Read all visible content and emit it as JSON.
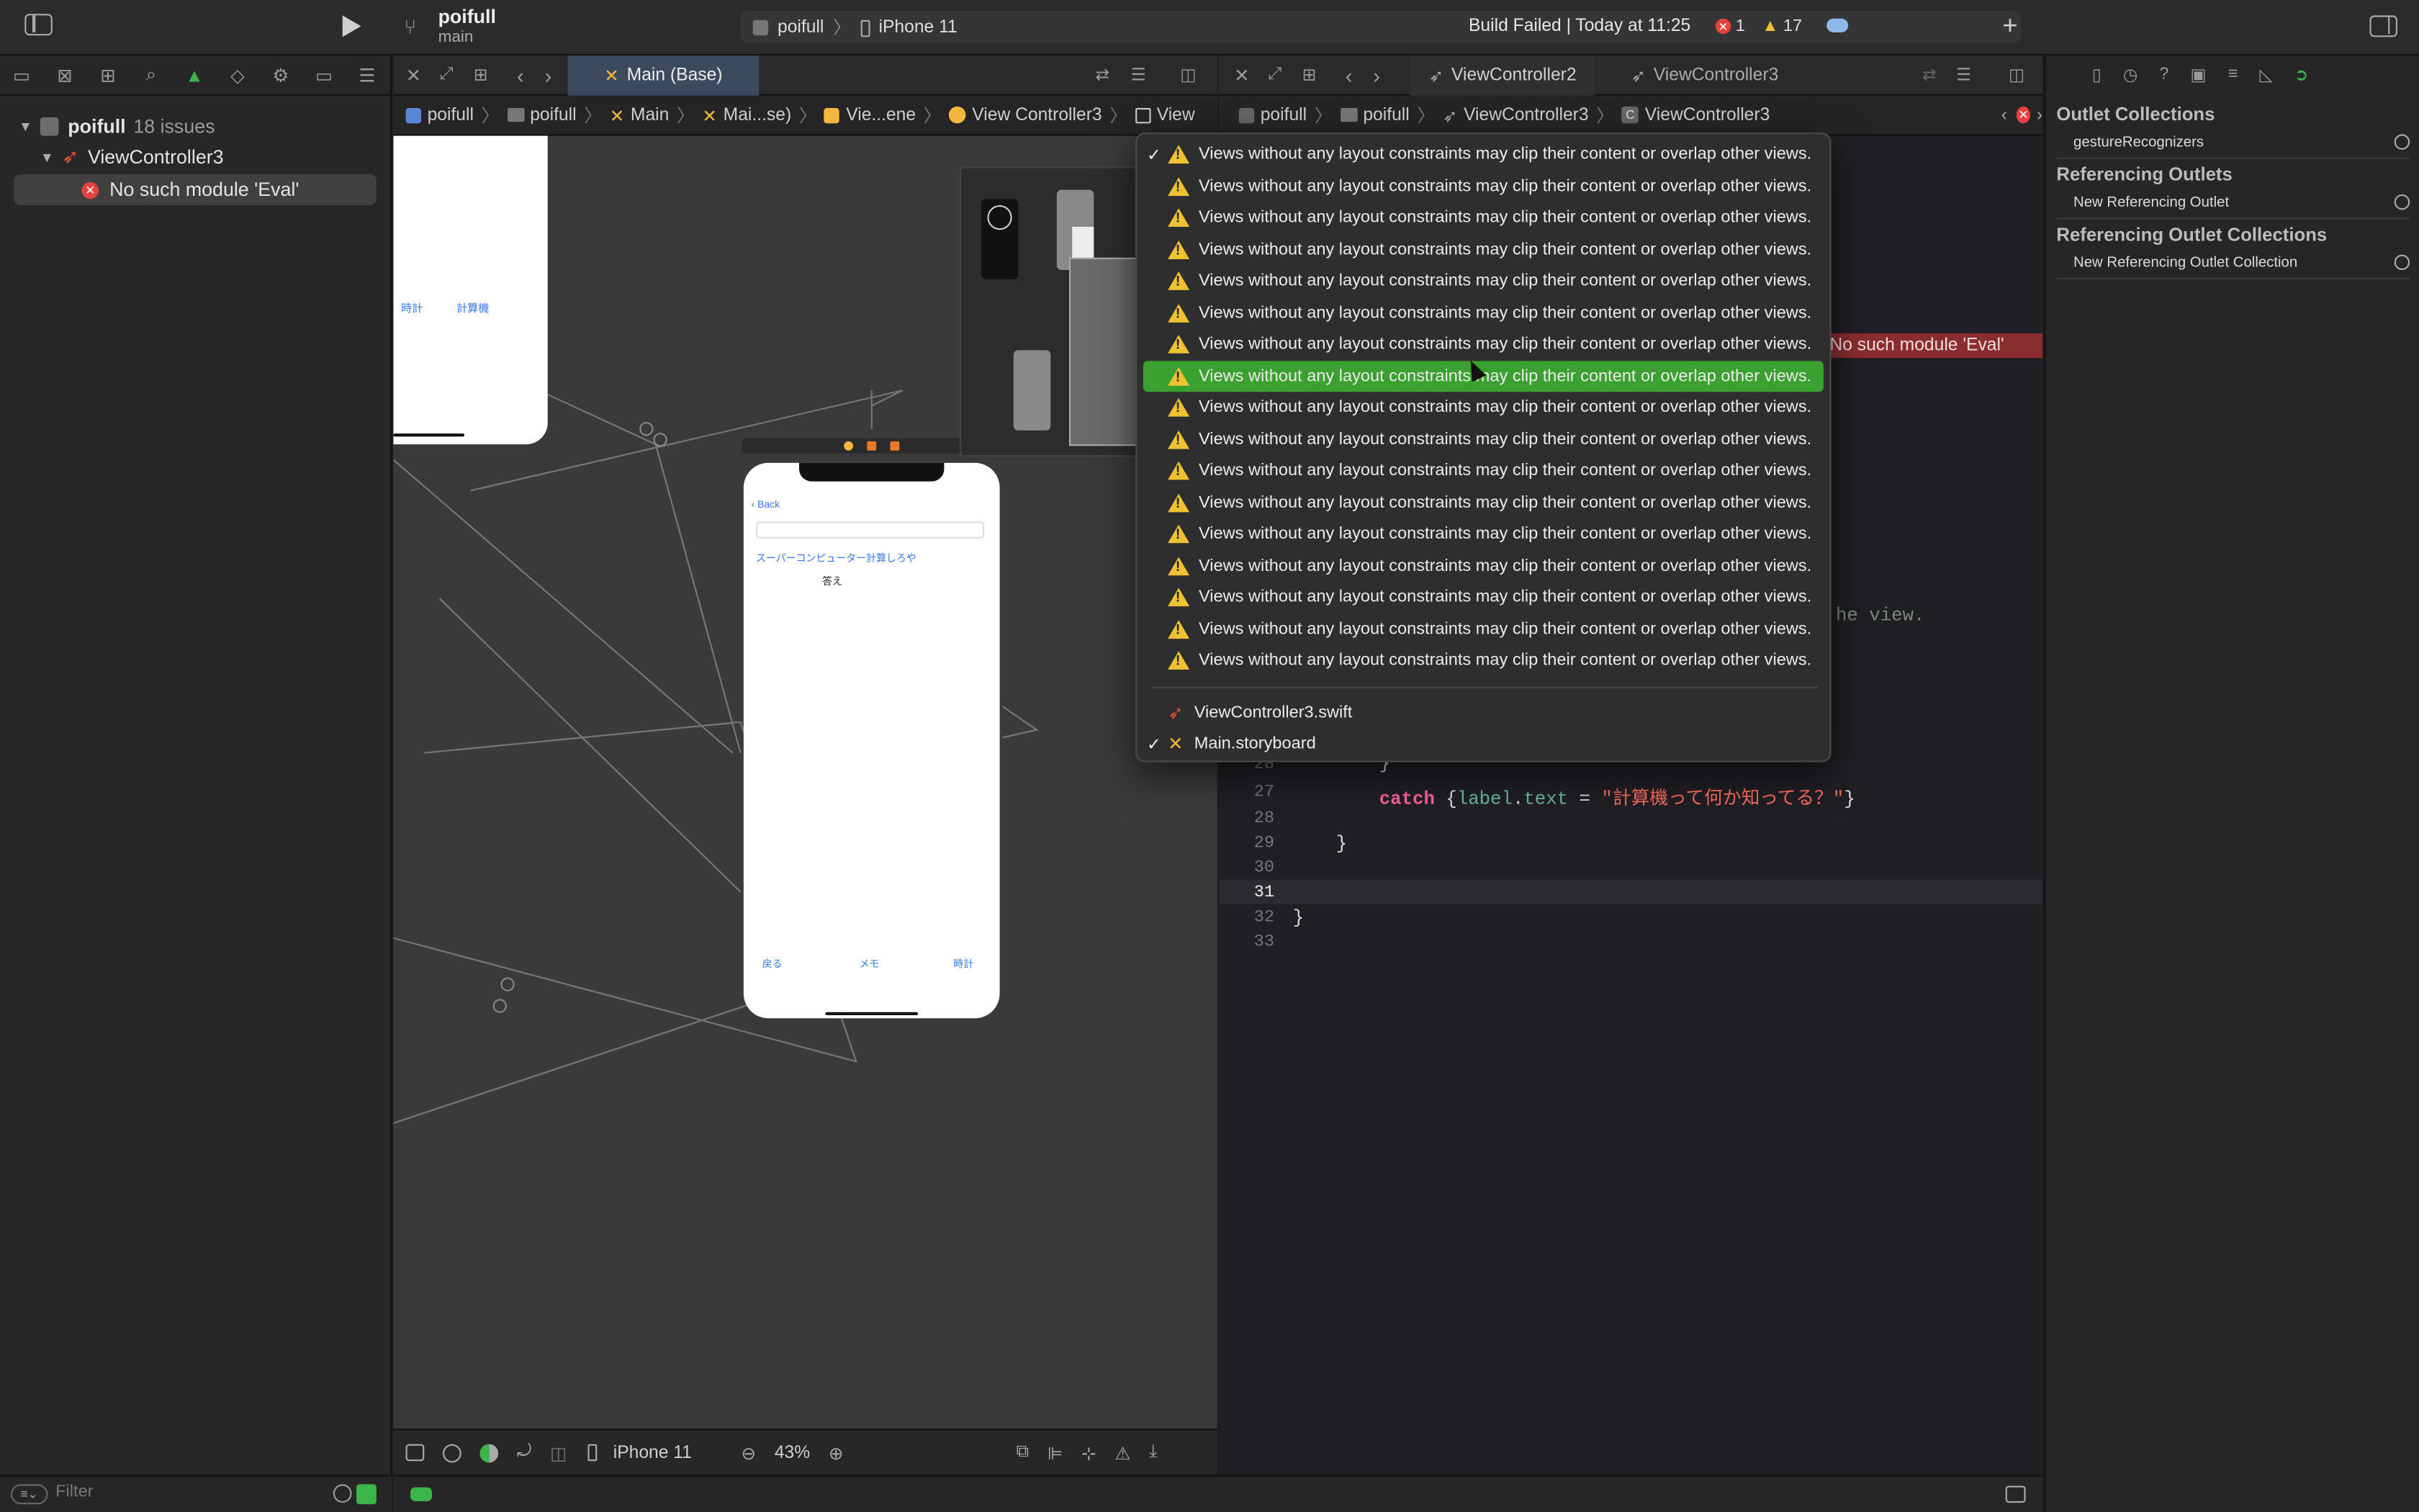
{
  "window": {
    "project": "poifull",
    "branch": "main",
    "scheme": "poifull",
    "device": "iPhone 11",
    "build_status": "Build Failed | Today at 11:25",
    "errors": "1",
    "warnings": "17"
  },
  "navigator": {
    "project": "poifull",
    "issues": "18 issues",
    "file": "ViewController3",
    "error": "No such module 'Eval'",
    "filter_placeholder": "Filter"
  },
  "left_editor": {
    "tab": "Main (Base)",
    "jump": [
      "poifull",
      "poifull",
      "Main",
      "Mai...se)",
      "Vie...ene",
      "View Controller3",
      "View"
    ]
  },
  "canvas": {
    "phone1": {
      "labels": [
        "時計",
        "計算機"
      ]
    },
    "phone2": {
      "back": "Back",
      "title": "スーパーコンピューター計算しろや",
      "answer": "答え",
      "bottom": [
        "戻る",
        "メモ",
        "時計"
      ]
    }
  },
  "canvas_bar": {
    "device": "iPhone 11",
    "zoom": "43%"
  },
  "right_editor": {
    "tabs": [
      "ViewController2",
      "ViewController3"
    ],
    "jump": [
      "poifull",
      "poifull",
      "ViewController3",
      "ViewController3"
    ],
    "error_banner": "No such module 'Eval'",
    "comment_fragment": "he view.",
    "lines": [
      {
        "n": "28",
        "code": ""
      },
      {
        "n": "27",
        "code": "catch {label.text = \"計算機って何か知ってる？\"}"
      },
      {
        "n": "28",
        "code": ""
      },
      {
        "n": "29",
        "code": "}"
      },
      {
        "n": "30",
        "code": ""
      },
      {
        "n": "31",
        "code": ""
      },
      {
        "n": "32",
        "code": "}"
      },
      {
        "n": "33",
        "code": ""
      }
    ]
  },
  "popup": {
    "warning_text": "Views without any layout constraints may clip their content or overlap other views.",
    "warning_count": 17,
    "selected_index": 7,
    "files": [
      "ViewController3.swift",
      "Main.storyboard"
    ]
  },
  "inspector": {
    "sections": [
      {
        "title": "Outlet Collections",
        "items": [
          "gestureRecognizers"
        ]
      },
      {
        "title": "Referencing Outlets",
        "items": [
          "New Referencing Outlet"
        ]
      },
      {
        "title": "Referencing Outlet Collections",
        "items": [
          "New Referencing Outlet Collection"
        ]
      }
    ]
  }
}
